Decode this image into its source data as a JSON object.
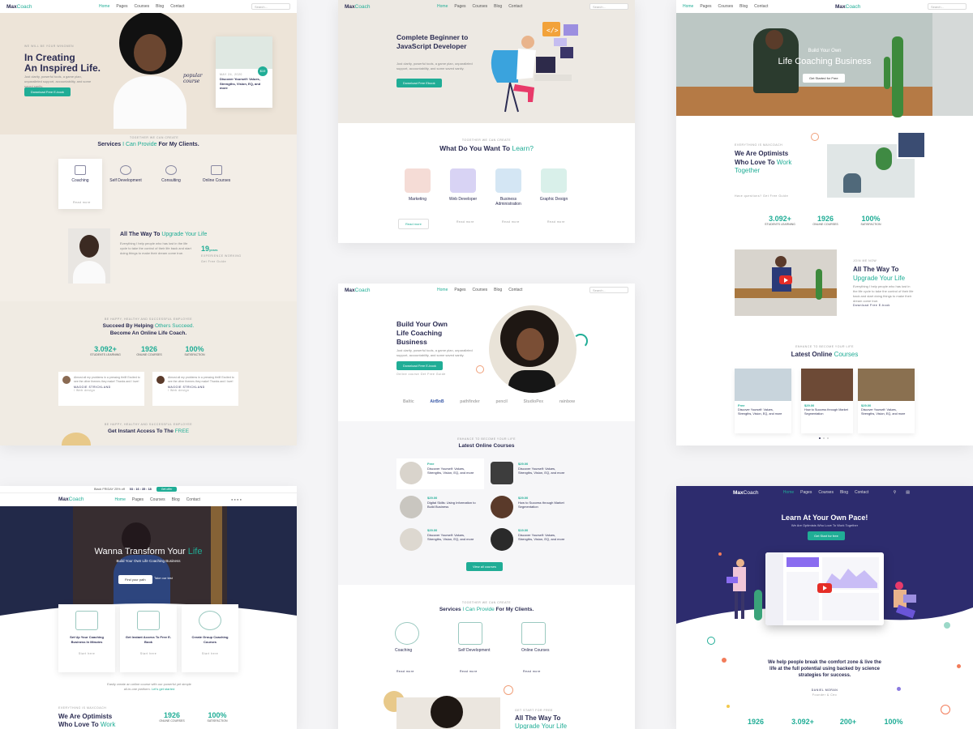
{
  "brand": {
    "logo_main": "Max",
    "logo_accent": "Coach",
    "accent": "#20ad96",
    "dark": "#2b2c52"
  },
  "nav": {
    "home": "Home",
    "pages": "Pages",
    "courses": "Courses",
    "blog": "Blog",
    "contact": "Contact",
    "search_placeholder": "Search..."
  },
  "card1": {
    "kicker": "WE WILL BE YOUR WINGMEN",
    "title_line1": "In Creating",
    "title_line2": "An Inspired Life.",
    "desc": "Just clarity, powerful tools, a game plan, unparalleled support, accountability, and some saved sanity.",
    "cta": "Download Free E-book",
    "script_label": "popular course",
    "course_badge": "$19",
    "course_date": "MAY 24, 2020",
    "course_title": "Discover Yourself: Values, Strengths, Vision, EQ, and more",
    "services_kicker": "TOGETHER WE CAN CREATE",
    "services_title_a": "Services",
    "services_title_b": "I Can Provide",
    "services_title_c": "For My Clients.",
    "services": [
      "Coaching",
      "Self Development",
      "Consulting",
      "Online Courses"
    ],
    "read_more": "Read more",
    "upgrade_title_a": "All The Way To",
    "upgrade_title_b": "Upgrade Your Life",
    "upgrade_text": "Everything I help people who has lost in the life cycle to take the control of their life back and start doing things to make their dream come true.",
    "years_num": "19",
    "years_unit": "years",
    "years_label": "EXPERIENCE WORKING",
    "get_started": "Get Free Guide",
    "succeed_kicker": "BE HAPPY, HEALTHY AND SUCCESSFUL EMPLOYEE",
    "succeed_a": "Succeed By Helping",
    "succeed_b": "Others Succeed.",
    "succeed_c": "Become An Online Life Coach.",
    "stats": [
      {
        "n": "3.092+",
        "l": "STUDENTS LEARNING"
      },
      {
        "n": "1926",
        "l": "ONLINE COURSES"
      },
      {
        "n": "100%",
        "l": "SATISFACTION"
      }
    ],
    "testimonial_text": "Almost all my problems in a pressing thrill! Excited to see the other themes they make! Thanks and I love!",
    "testimonial_name": "MAGGIE STRICKLAND",
    "testimonial_role": "/ Web design",
    "bottom_kicker": "BE HAPPY, HEALTHY AND SUCCESSFUL EMPLOYEE",
    "bottom_a": "Get Instant Access To The",
    "bottom_b": "FREE"
  },
  "card2": {
    "title": "Complete Beginner to JavaScript Developer",
    "desc": "Just clarity, powerful tools, a game plan, unparalleled support, accountability, and some saved sanity.",
    "cta": "Download Free Ebook",
    "kicker": "TOGETHER WE CAN CREATE",
    "question_a": "What Do You Want To",
    "question_b": "Learn?",
    "categories": [
      "Marketing",
      "Web Developer",
      "Business Administration",
      "Graphic Design"
    ],
    "read_more": "Read more"
  },
  "card3": {
    "hero_a": "Build Your Own",
    "hero_b": "Life Coaching Business",
    "hero_cta": "Get Started for Free",
    "kicker": "EVERYTHING IS MAXCOACH",
    "optimist_a": "We Are Optimists",
    "optimist_b": "Who Love To",
    "optimist_c": "Work",
    "optimist_d": "Together",
    "question_link": "Have questions? Get Free Guide",
    "stats": [
      {
        "n": "3.092+",
        "l": "STUDENTS LEARNING"
      },
      {
        "n": "1926",
        "l": "ONLINE COURSES"
      },
      {
        "n": "100%",
        "l": "SATISFACTION"
      }
    ],
    "upgrade_kicker": "JOIN ME NOW",
    "upgrade_a": "All The Way To",
    "upgrade_b": "Upgrade Your Life",
    "upgrade_text": "Everything I help people who has lost in the life cycle to take the control of their life back and start doing things to make their dream come true.",
    "upgrade_link": "Download Free E-book",
    "latest_kicker": "ENHANCE TO BECOME YOUR LIFE",
    "latest_a": "Latest Online",
    "latest_b": "Courses",
    "courses": [
      {
        "price": "Free",
        "title": "Discover Yourself: Values, Strengths, Vision, EQ, and more"
      },
      {
        "price": "$29.00",
        "title": "How to Success through Market Segmentation"
      },
      {
        "price": "$29.00",
        "title": "Discover Yourself: Values, Strengths, Vision, EQ, and more"
      }
    ]
  },
  "card4": {
    "title_a": "Build Your Own",
    "title_b": "Life Coaching",
    "title_c": "Business",
    "desc": "Just clarity, powerful tools, a game plan, unparalleled support, accountability, and some saved sanity.",
    "cta": "Download Free E-book",
    "link": "Online course  Get Free Guide",
    "partners": [
      "Baltic",
      "AirBnB",
      "pathfinder",
      "pencil",
      "StudioPex",
      "rainbow"
    ],
    "courses_kicker": "ENHANCE TO BECOME YOUR LIFE",
    "courses_title": "Latest Online Courses",
    "courses": [
      {
        "price": "Free",
        "title": "Discover Yourself: Values, Strengths, Vision, EQ, and more"
      },
      {
        "price": "$29.00",
        "title": "Discover Yourself: Values, Strengths, Vision, EQ, and more"
      },
      {
        "price": "$29.00",
        "title": "Digital Skills: Using Information to Build Business"
      },
      {
        "price": "$29.00",
        "title": "How to Success through Market Segmentation"
      },
      {
        "price": "$29.00",
        "title": "Discover Yourself: Values, Strengths, Vision, EQ, and more"
      },
      {
        "price": "$19.00",
        "title": "Discover Yourself: Values, Strengths, Vision, EQ, and more"
      }
    ],
    "view_all": "View all courses",
    "services_kicker": "TOGETHER WE CAN CREATE",
    "services_a": "Services",
    "services_b": "I Can Provide",
    "services_c": "For My Clients.",
    "services": [
      "Coaching",
      "Self Development",
      "Online Courses"
    ],
    "read_more": "Read more",
    "upgrade_kicker": "GET START FOR FREE",
    "upgrade_a": "All The Way To",
    "upgrade_b": "Upgrade Your Life"
  },
  "card5": {
    "topbar": "Black FRIDAY 25% off",
    "countdown": "03 : 16 : 35 : 18",
    "topbar_btn": "Get offer",
    "hero_a": "Wanna Transform Your",
    "hero_b": "Life",
    "hero_sub": "Build Your Own Life Coaching Business",
    "btn1": "Find your path",
    "btn2": "Take our test",
    "boxes": [
      {
        "title": "Set Up Your Coaching Business In Minutes",
        "link": "Start here"
      },
      {
        "title": "Get Instant Access To Free E-Book",
        "link": "Start here"
      },
      {
        "title": "Create Group Coaching Courses",
        "link": "Start here"
      }
    ],
    "footer_note": "Easily create an online course with our powerful yet simple all-in-one platform.",
    "footer_link": "Let's get started",
    "kicker": "EVERYTHING IS MAXCOACH",
    "optimist_a": "We Are Optimists",
    "optimist_b": "Who Love To",
    "optimist_c": "Work",
    "stats": [
      {
        "n": "1926",
        "l": "ONLINE COURSES"
      },
      {
        "n": "100%",
        "l": "SATISFACTION"
      }
    ]
  },
  "card6": {
    "title": "Learn At Your Own Pace!",
    "sub": "We Are Optimists Who Love To Work Together",
    "cta": "Get Start for free",
    "mission": "We help people break the comfort zone & live the life at the full potential using backed by science strategies for success.",
    "signer": "DANIEL MORAN",
    "signer_role": "Founder & Ceo",
    "stats": [
      "1926",
      "3.092+",
      "200+",
      "100%"
    ]
  }
}
